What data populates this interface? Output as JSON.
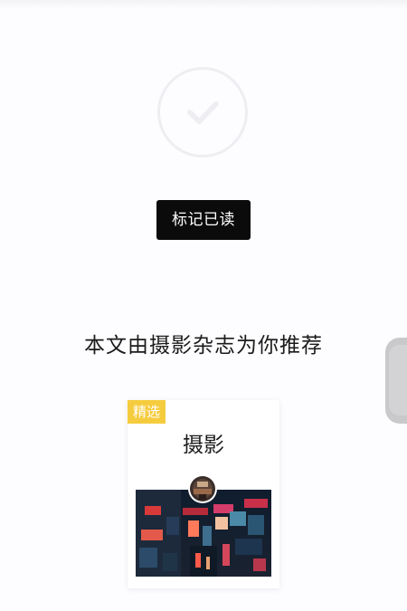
{
  "mark_read": {
    "label": "标记已读"
  },
  "recommendation": {
    "text": "本文由摄影杂志为你推荐"
  },
  "card": {
    "badge": "精选",
    "title": "摄影"
  },
  "icons": {
    "status": "checkmark-circle-icon",
    "avatar": "magazine-avatar",
    "cover": "city-night-photo"
  },
  "colors": {
    "button_bg": "#0b0b0b",
    "badge_bg": "#f6cc3f",
    "check_stroke": "#eeeef2",
    "text": "#1b1b1b"
  }
}
